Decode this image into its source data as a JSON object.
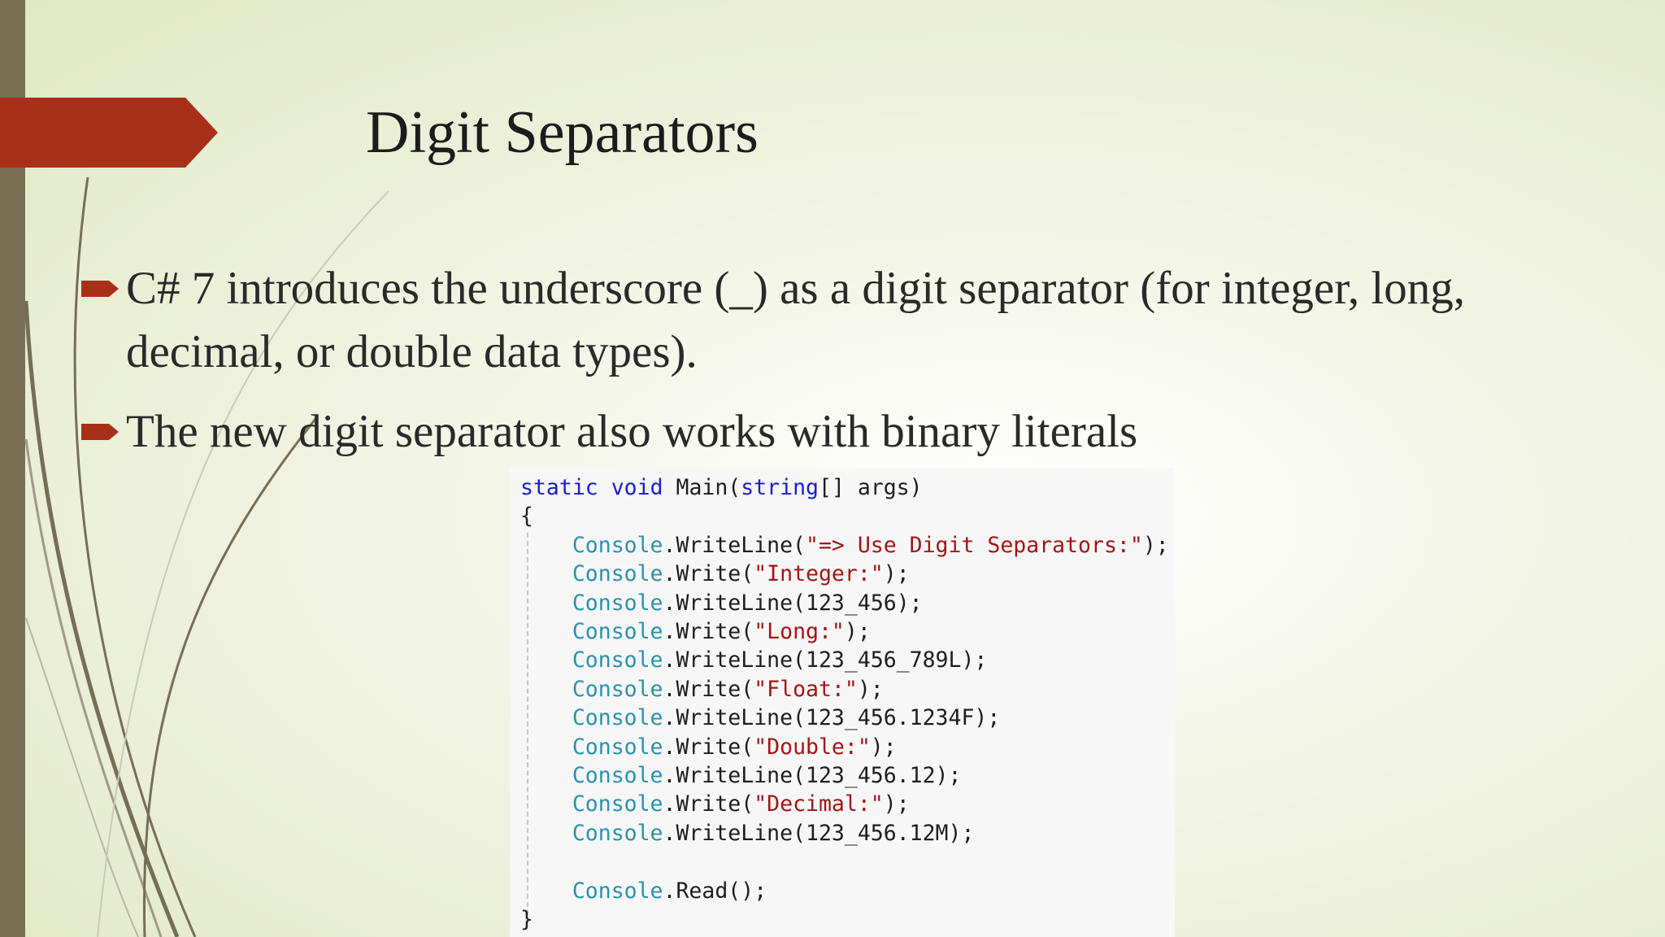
{
  "slide": {
    "title": "Digit Separators",
    "bullets": [
      "C# 7 introduces the underscore (_) as a digit separator (for integer, long, decimal, or double data types).",
      "The new digit separator also works with binary literals"
    ]
  },
  "code": {
    "lines": [
      {
        "name": "code-line-signature",
        "tokens": [
          {
            "t": "static",
            "k": "kw"
          },
          {
            "t": " "
          },
          {
            "t": "void",
            "k": "kw"
          },
          {
            "t": " Main("
          },
          {
            "t": "string",
            "k": "kw"
          },
          {
            "t": "[] args)"
          }
        ]
      },
      {
        "name": "code-line-open-brace",
        "tokens": [
          {
            "t": "{"
          }
        ]
      },
      {
        "name": "code-line",
        "tokens": [
          {
            "t": "    "
          },
          {
            "t": "Console",
            "k": "ty"
          },
          {
            "t": ".WriteLine("
          },
          {
            "t": "\"=> Use Digit Separators:\"",
            "k": "str"
          },
          {
            "t": ");"
          }
        ]
      },
      {
        "name": "code-line",
        "tokens": [
          {
            "t": "    "
          },
          {
            "t": "Console",
            "k": "ty"
          },
          {
            "t": ".Write("
          },
          {
            "t": "\"Integer:\"",
            "k": "str"
          },
          {
            "t": ");"
          }
        ]
      },
      {
        "name": "code-line",
        "tokens": [
          {
            "t": "    "
          },
          {
            "t": "Console",
            "k": "ty"
          },
          {
            "t": ".WriteLine(123_456);"
          }
        ]
      },
      {
        "name": "code-line",
        "tokens": [
          {
            "t": "    "
          },
          {
            "t": "Console",
            "k": "ty"
          },
          {
            "t": ".Write("
          },
          {
            "t": "\"Long:\"",
            "k": "str"
          },
          {
            "t": ");"
          }
        ]
      },
      {
        "name": "code-line",
        "tokens": [
          {
            "t": "    "
          },
          {
            "t": "Console",
            "k": "ty"
          },
          {
            "t": ".WriteLine(123_456_789L);"
          }
        ]
      },
      {
        "name": "code-line",
        "tokens": [
          {
            "t": "    "
          },
          {
            "t": "Console",
            "k": "ty"
          },
          {
            "t": ".Write("
          },
          {
            "t": "\"Float:\"",
            "k": "str"
          },
          {
            "t": ");"
          }
        ]
      },
      {
        "name": "code-line",
        "tokens": [
          {
            "t": "    "
          },
          {
            "t": "Console",
            "k": "ty"
          },
          {
            "t": ".WriteLine(123_456.1234F);"
          }
        ]
      },
      {
        "name": "code-line",
        "tokens": [
          {
            "t": "    "
          },
          {
            "t": "Console",
            "k": "ty"
          },
          {
            "t": ".Write("
          },
          {
            "t": "\"Double:\"",
            "k": "str"
          },
          {
            "t": ");"
          }
        ]
      },
      {
        "name": "code-line",
        "tokens": [
          {
            "t": "    "
          },
          {
            "t": "Console",
            "k": "ty"
          },
          {
            "t": ".WriteLine(123_456.12);"
          }
        ]
      },
      {
        "name": "code-line",
        "tokens": [
          {
            "t": "    "
          },
          {
            "t": "Console",
            "k": "ty"
          },
          {
            "t": ".Write("
          },
          {
            "t": "\"Decimal:\"",
            "k": "str"
          },
          {
            "t": ");"
          }
        ]
      },
      {
        "name": "code-line",
        "tokens": [
          {
            "t": "    "
          },
          {
            "t": "Console",
            "k": "ty"
          },
          {
            "t": ".WriteLine(123_456.12M);"
          }
        ]
      },
      {
        "name": "code-line-blank",
        "tokens": [
          {
            "t": ""
          }
        ]
      },
      {
        "name": "code-line",
        "tokens": [
          {
            "t": "    "
          },
          {
            "t": "Console",
            "k": "ty"
          },
          {
            "t": ".Read();"
          }
        ]
      },
      {
        "name": "code-line-close-brace",
        "tokens": [
          {
            "t": "}"
          }
        ]
      }
    ]
  },
  "colors": {
    "accent": "#a83018",
    "sidebar": "#7b7056",
    "keyword": "#1a20c8",
    "type": "#2b91af",
    "string": "#a31515"
  },
  "icons": {
    "bullet": "arrow-bullet-icon",
    "title_marker": "title-arrow-icon"
  }
}
